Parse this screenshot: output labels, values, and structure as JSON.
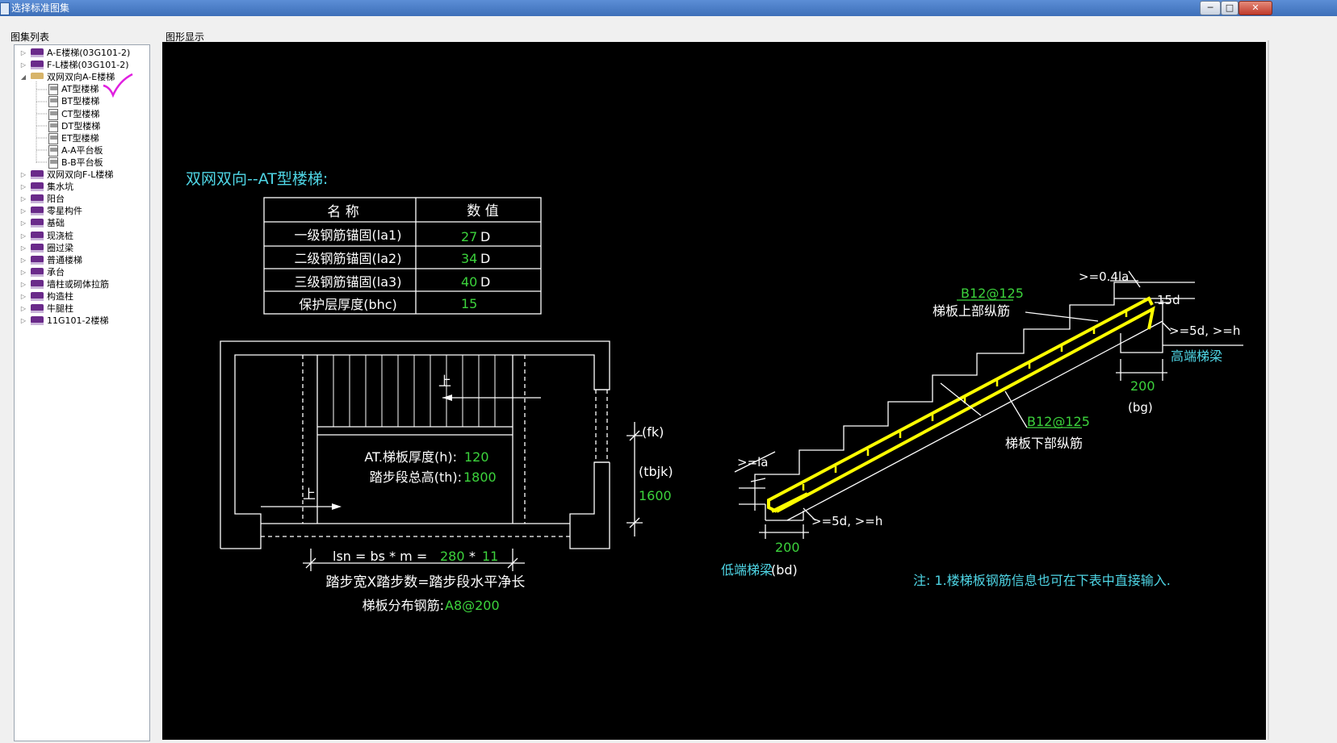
{
  "window": {
    "title": "选择标准图集",
    "minimize_label": "─",
    "maximize_label": "□",
    "close_label": "✕"
  },
  "panels": {
    "tree_label": "图集列表",
    "display_label": "图形显示"
  },
  "tree": {
    "items": [
      {
        "label": "A-E楼梯(03G101-2)",
        "icon": "book-icon",
        "expanded": false
      },
      {
        "label": "F-L楼梯(03G101-2)",
        "icon": "book-icon",
        "expanded": false
      },
      {
        "label": "双网双向A-E楼梯",
        "icon": "open-book-icon",
        "expanded": true
      },
      {
        "label": "AT型楼梯",
        "icon": "document-icon",
        "child": true,
        "selected": true
      },
      {
        "label": "BT型楼梯",
        "icon": "document-icon",
        "child": true
      },
      {
        "label": "CT型楼梯",
        "icon": "document-icon",
        "child": true
      },
      {
        "label": "DT型楼梯",
        "icon": "document-icon",
        "child": true
      },
      {
        "label": "ET型楼梯",
        "icon": "document-icon",
        "child": true
      },
      {
        "label": "A-A平台板",
        "icon": "document-icon",
        "child": true
      },
      {
        "label": "B-B平台板",
        "icon": "document-icon",
        "child": true
      },
      {
        "label": "双网双向F-L楼梯",
        "icon": "book-icon",
        "expanded": false
      },
      {
        "label": "集水坑",
        "icon": "book-icon",
        "expanded": false
      },
      {
        "label": "阳台",
        "icon": "book-icon",
        "expanded": false
      },
      {
        "label": "零星构件",
        "icon": "book-icon",
        "expanded": false
      },
      {
        "label": "基础",
        "icon": "book-icon",
        "expanded": false
      },
      {
        "label": "现浇桩",
        "icon": "book-icon",
        "expanded": false
      },
      {
        "label": "圈过梁",
        "icon": "book-icon",
        "expanded": false
      },
      {
        "label": "普通楼梯",
        "icon": "book-icon",
        "expanded": false
      },
      {
        "label": "承台",
        "icon": "book-icon",
        "expanded": false
      },
      {
        "label": "墙柱或砌体拉筋",
        "icon": "book-icon",
        "expanded": false
      },
      {
        "label": "构造柱",
        "icon": "book-icon",
        "expanded": false
      },
      {
        "label": "牛腿柱",
        "icon": "book-icon",
        "expanded": false
      },
      {
        "label": "11G101-2楼梯",
        "icon": "book-icon",
        "expanded": false
      }
    ]
  },
  "drawing": {
    "title": "双网双向--AT型楼梯:",
    "table": {
      "headers": [
        "名 称",
        "数 值"
      ],
      "rows": [
        {
          "name": "一级钢筋锚固(la1)",
          "value": "27",
          "unit": "D"
        },
        {
          "name": "二级钢筋锚固(la2)",
          "value": "34",
          "unit": "D"
        },
        {
          "name": "三级钢筋锚固(la3)",
          "value": "40",
          "unit": "D"
        },
        {
          "name": "保护层厚度(bhc)",
          "value": "15",
          "unit": ""
        }
      ]
    },
    "plan": {
      "up_label_1": "上",
      "up_label_2": "上",
      "thickness_label": "AT.梯板厚度(h):",
      "thickness_value": "120",
      "height_label": "踏步段总高(th):",
      "height_value": "1800",
      "fk_label": "(fk)",
      "tbjk_label": "(tbjk)",
      "tbjk_value": "1600",
      "lsn_formula": "lsn = bs * m =",
      "bs_value": "280",
      "star": "*",
      "m_value": "11",
      "formula_caption": "踏步宽X踏步数=踏步段水平净长",
      "distribution_label": "梯板分布钢筋:",
      "distribution_value": "A8@200"
    },
    "section": {
      "top_bar_spec": "B12@125",
      "top_bar_label": "梯板上部纵筋",
      "bottom_bar_spec": "B12@125",
      "bottom_bar_label": "梯板下部纵筋",
      "anchor_top": ">=0.4la",
      "anchor_15d": "15d",
      "anchor_high": ">=5d, >=h",
      "high_beam_label": "高端梯梁",
      "bg_value": "200",
      "bg_label": "(bg)",
      "la_label": ">=la",
      "anchor_low": ">=5d, >=h",
      "bd_value": "200",
      "low_beam_label": "低端梯梁",
      "bd_label": "(bd)",
      "note": "注: 1.楼梯板钢筋信息也可在下表中直接输入."
    }
  },
  "colors": {
    "canvas": "#000000",
    "white_line": "#ffffff",
    "cyan_text": "#4fd6e6",
    "green_value": "#3cd33c",
    "rebar_yellow": "#ffff00",
    "check_mark": "#e020e0"
  }
}
